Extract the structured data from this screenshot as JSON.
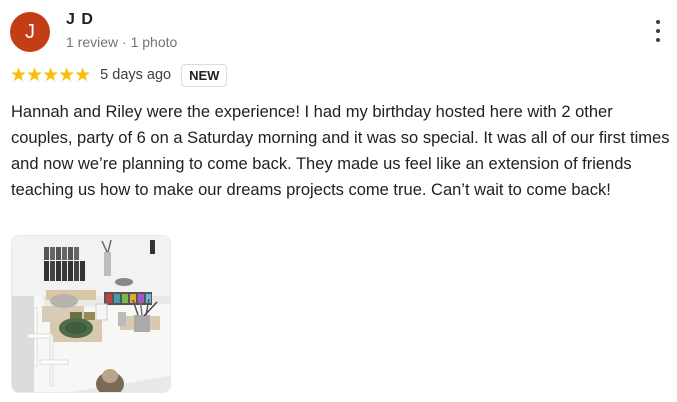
{
  "reviewer": {
    "initial": "J",
    "name": "J D",
    "meta": "1 review · 1 photo",
    "avatar_color": "#c33d17"
  },
  "rating": {
    "stars": 5,
    "stars_text": "★★★★★",
    "star_color": "#fbbc04",
    "time_ago": "5 days ago",
    "badge": "NEW"
  },
  "review_text": "Hannah and Riley were the experience! I had my birthday hosted here with 2 other couples, party of 6 on a Saturday morning and it was so special. It was all of our first times and now we’re planning to come back. They made us feel like an extension of friends teaching us how to make our dreams projects come true. Can’t wait to come back!",
  "icons": {
    "more": "more-vert-icon"
  }
}
